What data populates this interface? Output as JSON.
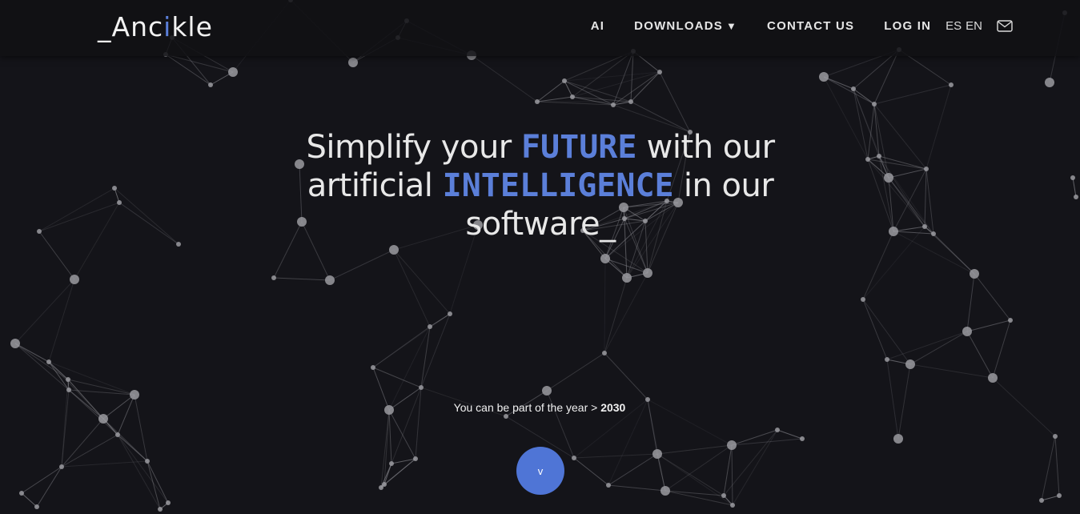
{
  "brand": {
    "prefix": "_A",
    "mid1": "nc",
    "accent_i": "i",
    "rest": "kle"
  },
  "nav": {
    "ai": "AI",
    "downloads": "DOWNLOADS",
    "downloads_caret": "▼",
    "contact": "CONTACT US",
    "login": "LOG IN",
    "lang_es": "ES",
    "lang_en": "EN",
    "mail_icon": "mail-icon"
  },
  "hero": {
    "part1": "Simplify your ",
    "highlight1": "FUTURE",
    "part2": " with our artificial ",
    "highlight2": "INTELLIGENCE",
    "part3": " in our software_"
  },
  "subtitle": {
    "text": "You can be part of the year > ",
    "year": "2030"
  },
  "scroll_button": {
    "label": "v"
  },
  "colors": {
    "accent": "#5b7fd9",
    "background": "#141419",
    "button": "#4f75d6"
  }
}
